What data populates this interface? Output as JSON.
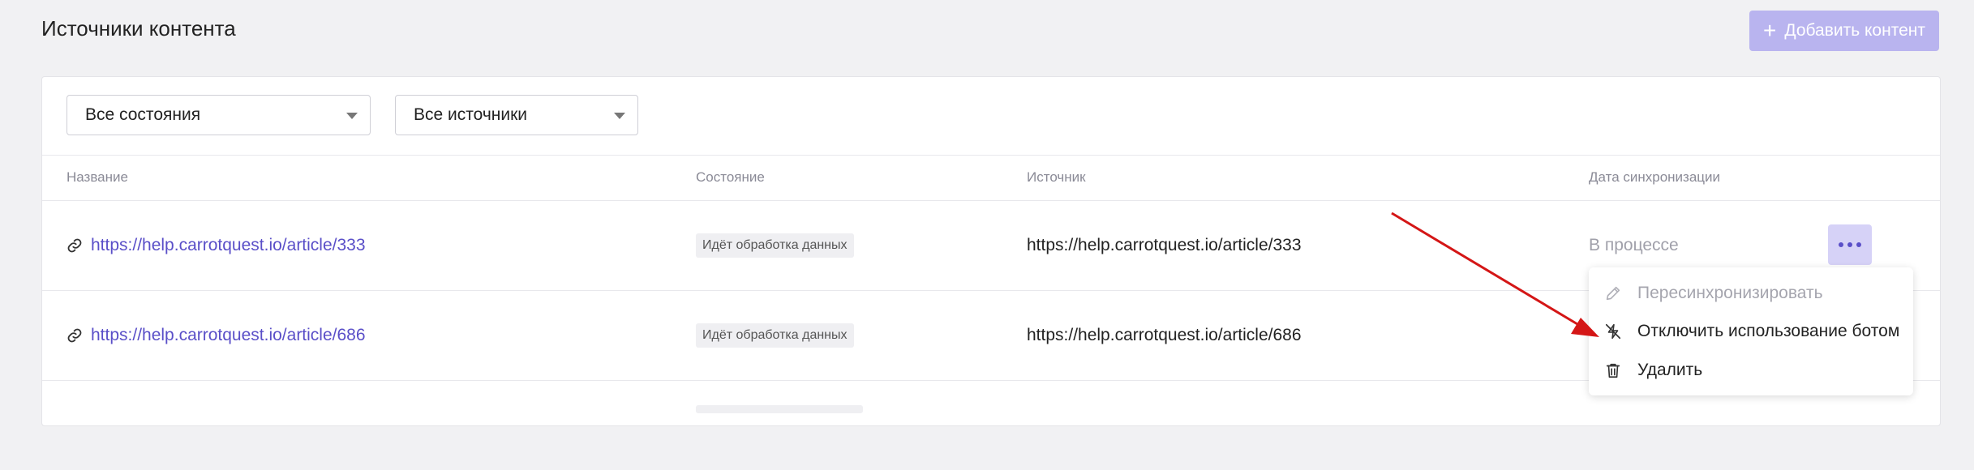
{
  "header": {
    "title": "Источники контента",
    "add_button": "Добавить контент"
  },
  "filters": {
    "state": "Все состояния",
    "source": "Все источники"
  },
  "table": {
    "columns": [
      "Название",
      "Состояние",
      "Источник",
      "Дата синхронизации"
    ],
    "rows": [
      {
        "name": "https://help.carrotquest.io/article/333",
        "state": "Идёт обработка данных",
        "source": "https://help.carrotquest.io/article/333",
        "sync": "В процессе"
      },
      {
        "name": "https://help.carrotquest.io/article/686",
        "state": "Идёт обработка данных",
        "source": "https://help.carrotquest.io/article/686",
        "sync": ""
      }
    ]
  },
  "menu": {
    "items": [
      {
        "label": "Пересинхронизировать",
        "icon": "pencil-icon",
        "disabled": true
      },
      {
        "label": "Отключить использование ботом",
        "icon": "bot-off-icon",
        "disabled": false
      },
      {
        "label": "Удалить",
        "icon": "trash-icon",
        "disabled": false
      }
    ]
  },
  "colors": {
    "accent": "#5a4fc8",
    "accent_light": "#d6d2f7",
    "button_disabled": "#b9b4ef",
    "annotation_arrow": "#d41616"
  }
}
